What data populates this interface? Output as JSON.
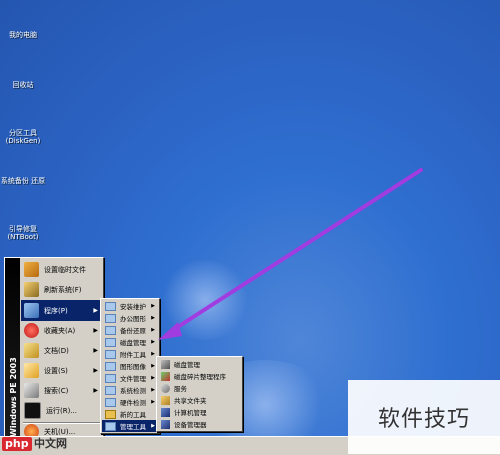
{
  "desktop": {
    "icons": [
      {
        "label": "我的电脑"
      },
      {
        "label": "回收站"
      },
      {
        "label": "分区工具 (DiskGen)"
      },
      {
        "label": "系统备份 还原"
      },
      {
        "label": "引导修复 (NTBoot)"
      }
    ]
  },
  "start_menu": {
    "sidebar_text": "Windows PE 2003",
    "items": [
      {
        "label": "设置临时文件",
        "icon": "settings-icon"
      },
      {
        "label": "刷新系统(F)",
        "icon": "refresh-icon"
      },
      {
        "label": "程序(P)",
        "icon": "programs-icon",
        "submenu": true
      },
      {
        "label": "收藏夹(A)",
        "icon": "favorites-icon",
        "submenu": true
      },
      {
        "label": "文档(D)",
        "icon": "documents-icon",
        "submenu": true
      },
      {
        "label": "设置(S)",
        "icon": "settings-icon",
        "submenu": true
      },
      {
        "label": "搜索(C)",
        "icon": "search-icon",
        "submenu": true
      },
      {
        "label": "运行(R)...",
        "icon": "run-icon"
      },
      {
        "label": "关机(U)...",
        "icon": "shutdown-icon"
      }
    ]
  },
  "programs_menu": {
    "items": [
      {
        "label": "安装维护"
      },
      {
        "label": "办公图形"
      },
      {
        "label": "备份还原"
      },
      {
        "label": "磁盘管理"
      },
      {
        "label": "附件工具"
      },
      {
        "label": "图形图像"
      },
      {
        "label": "文件管理"
      },
      {
        "label": "系统检测"
      },
      {
        "label": "硬件检测"
      },
      {
        "label": "新的工具"
      },
      {
        "label": "管理工具"
      }
    ]
  },
  "admin_tools_menu": {
    "items": [
      {
        "label": "磁盘管理",
        "icon": "disk-manager-icon"
      },
      {
        "label": "磁盘碎片整理程序",
        "icon": "defrag-icon"
      },
      {
        "label": "服务",
        "icon": "services-icon"
      },
      {
        "label": "共享文件夹",
        "icon": "shared-folder-icon"
      },
      {
        "label": "计算机管理",
        "icon": "computer-management-icon"
      },
      {
        "label": "设备管理器",
        "icon": "device-manager-icon"
      }
    ]
  },
  "branding": {
    "logo_php": "php",
    "logo_text": "中文网",
    "watermark": "软件技巧"
  },
  "colors": {
    "desktop": "#2f6fd0",
    "menu_bg": "#d4d0c8",
    "highlight": "#0a246a",
    "annotation_arrow": "#a13ce0"
  }
}
